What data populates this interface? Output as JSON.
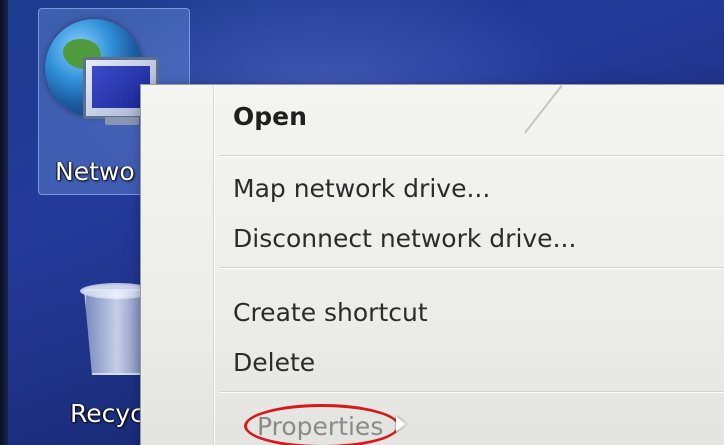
{
  "desktop": {
    "icons": [
      {
        "label": "Netwo",
        "icon": "network-globe-icon",
        "selected": true
      },
      {
        "label": "Recycle",
        "icon": "recycle-bin-icon",
        "selected": false
      }
    ]
  },
  "context_menu": {
    "items": [
      {
        "label": "Open",
        "bold": true
      },
      {
        "label": "Map network drive..."
      },
      {
        "label": "Disconnect network drive..."
      },
      {
        "label": "Create shortcut"
      },
      {
        "label": "Delete"
      },
      {
        "label": "Properties",
        "highlighted": true
      }
    ]
  },
  "annotation": {
    "color": "#d81818"
  }
}
